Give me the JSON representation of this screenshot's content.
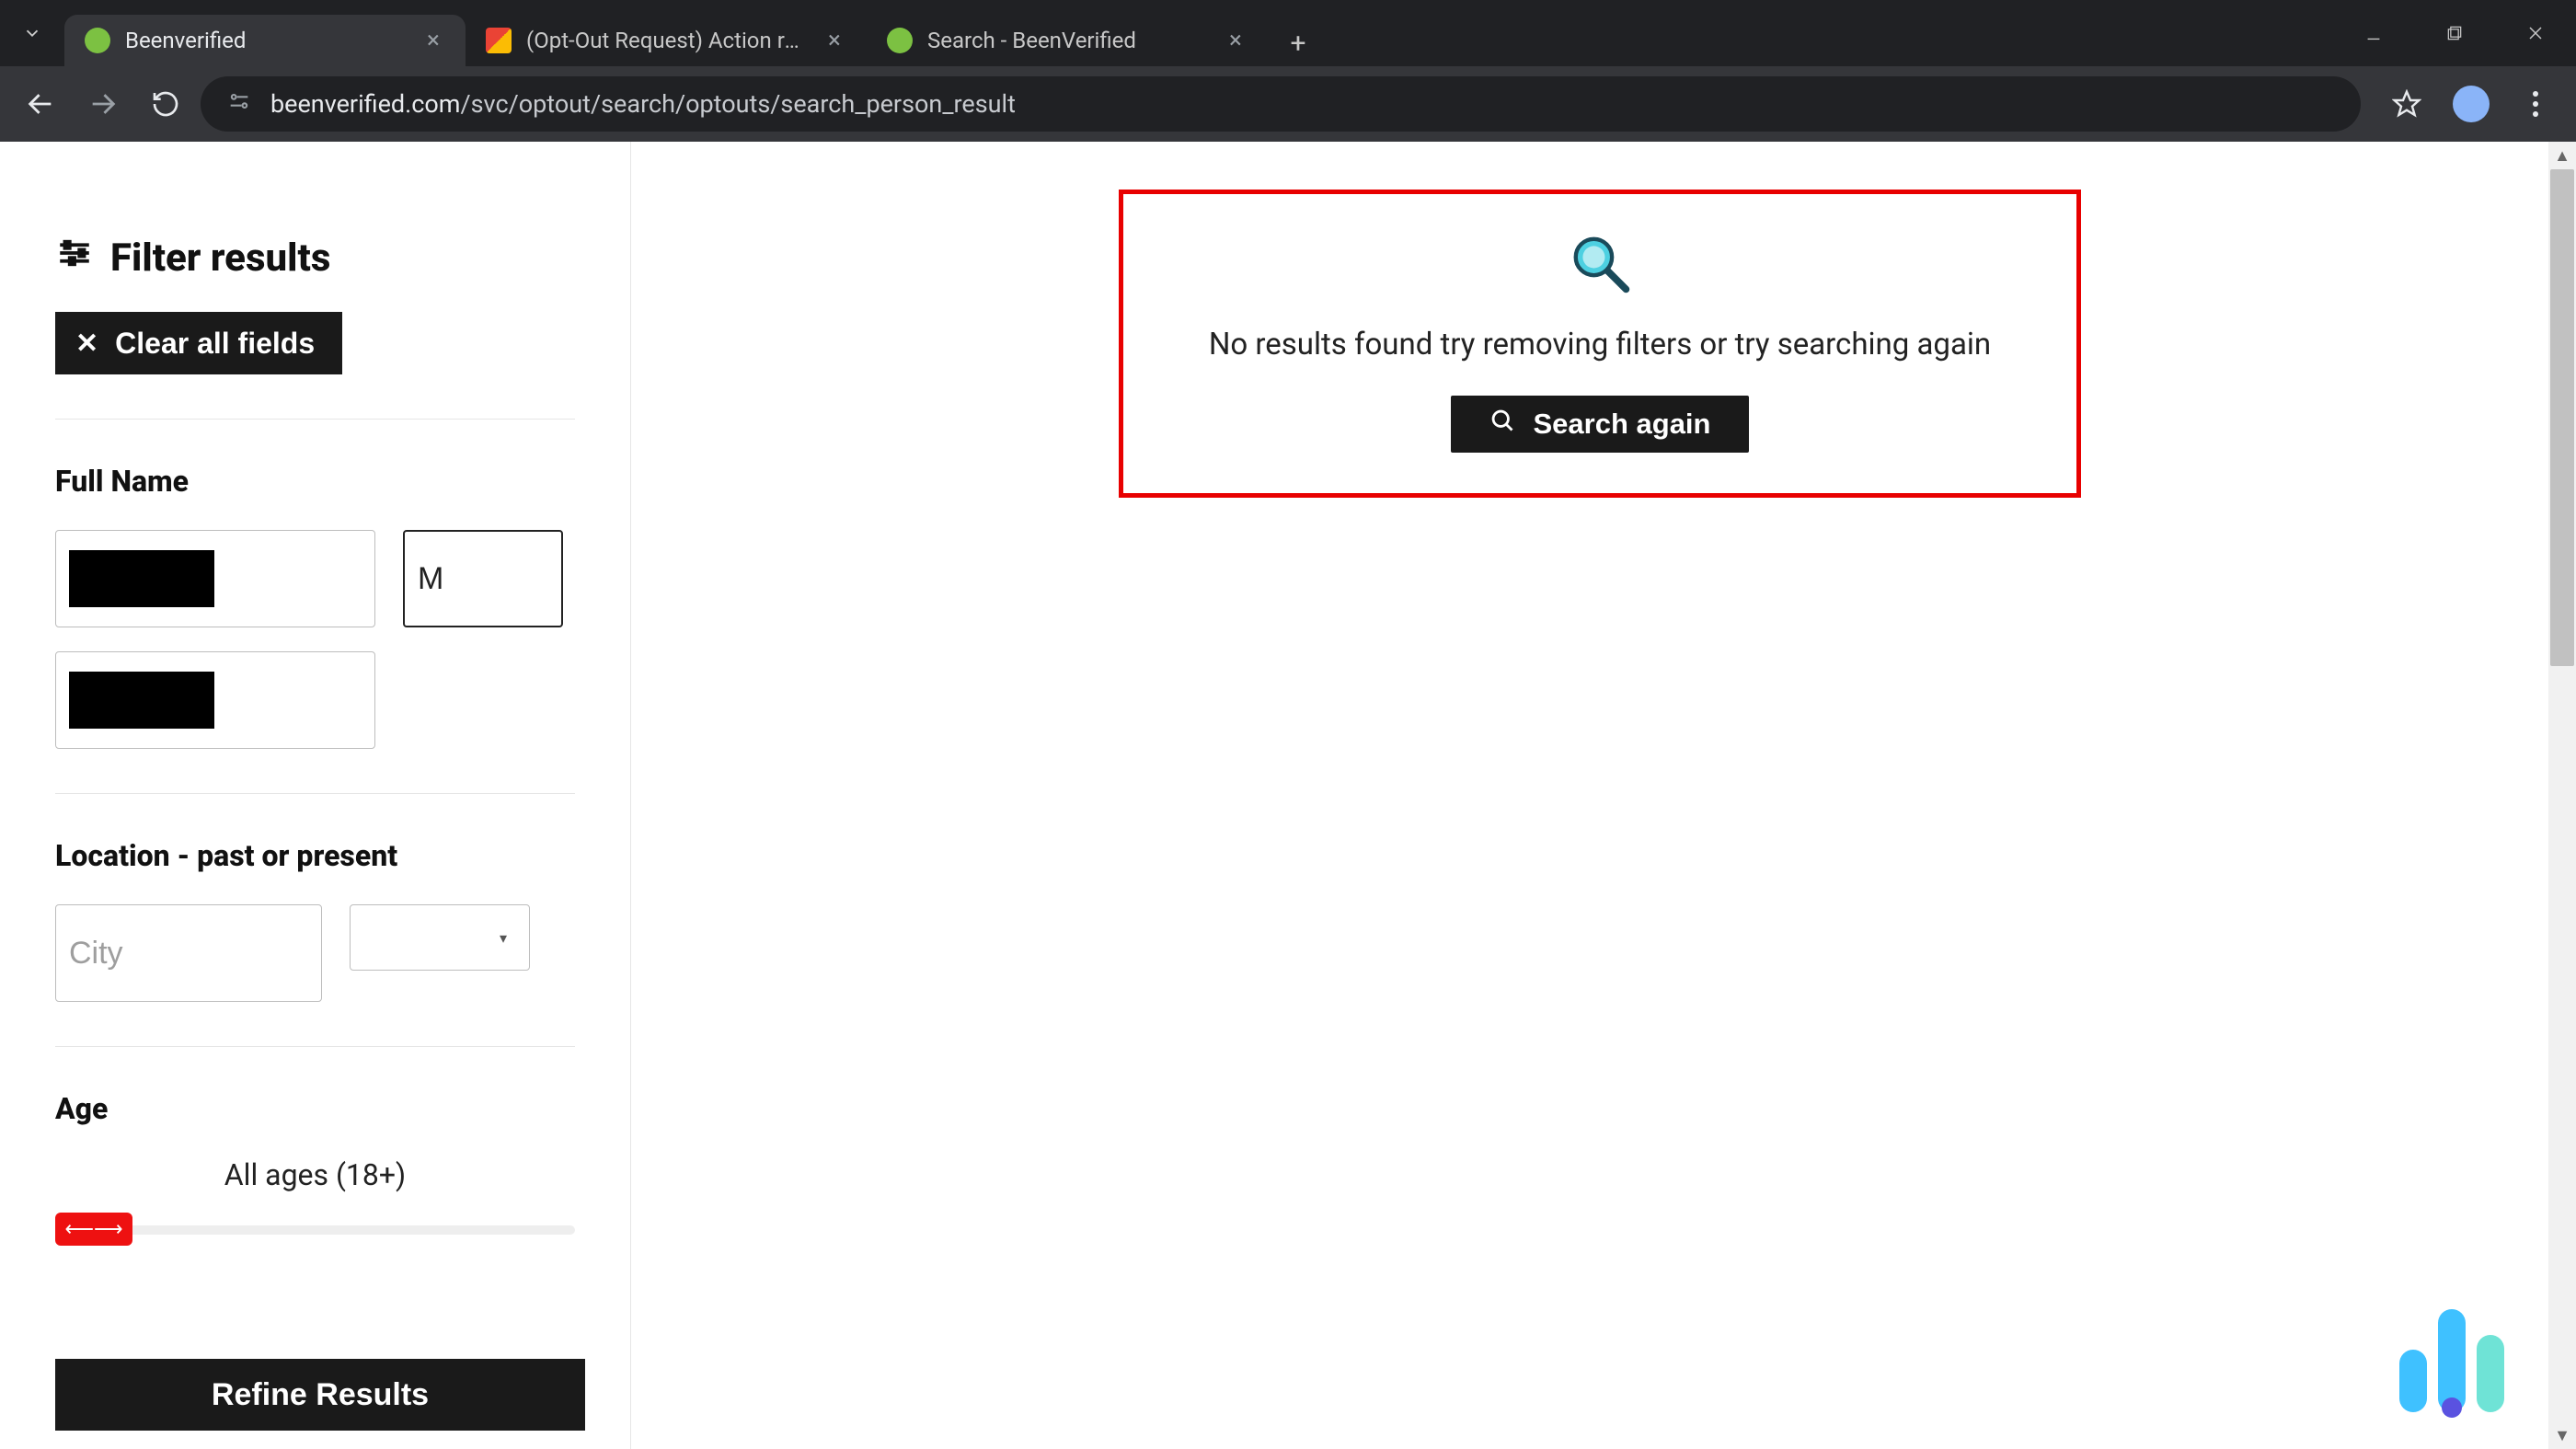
{
  "browser": {
    "tabs": [
      {
        "title": "Beenverified",
        "active": true
      },
      {
        "title": "(Opt-Out Request) Action requi",
        "active": false
      },
      {
        "title": "Search - BeenVerified",
        "active": false
      }
    ],
    "url_prefix": "beenverified.com",
    "url_path": "/svc/optout/search/optouts/search_person_result"
  },
  "sidebar": {
    "heading": "Filter results",
    "clear_label": "Clear all fields",
    "full_name_label": "Full Name",
    "mi_value": "M",
    "location_label": "Location - past or present",
    "city_placeholder": "City",
    "age_label": "Age",
    "age_value_text": "All ages (18+)",
    "refine_label": "Refine Results"
  },
  "results": {
    "message": "No results found try removing filters or try searching again",
    "search_again_label": "Search again"
  }
}
